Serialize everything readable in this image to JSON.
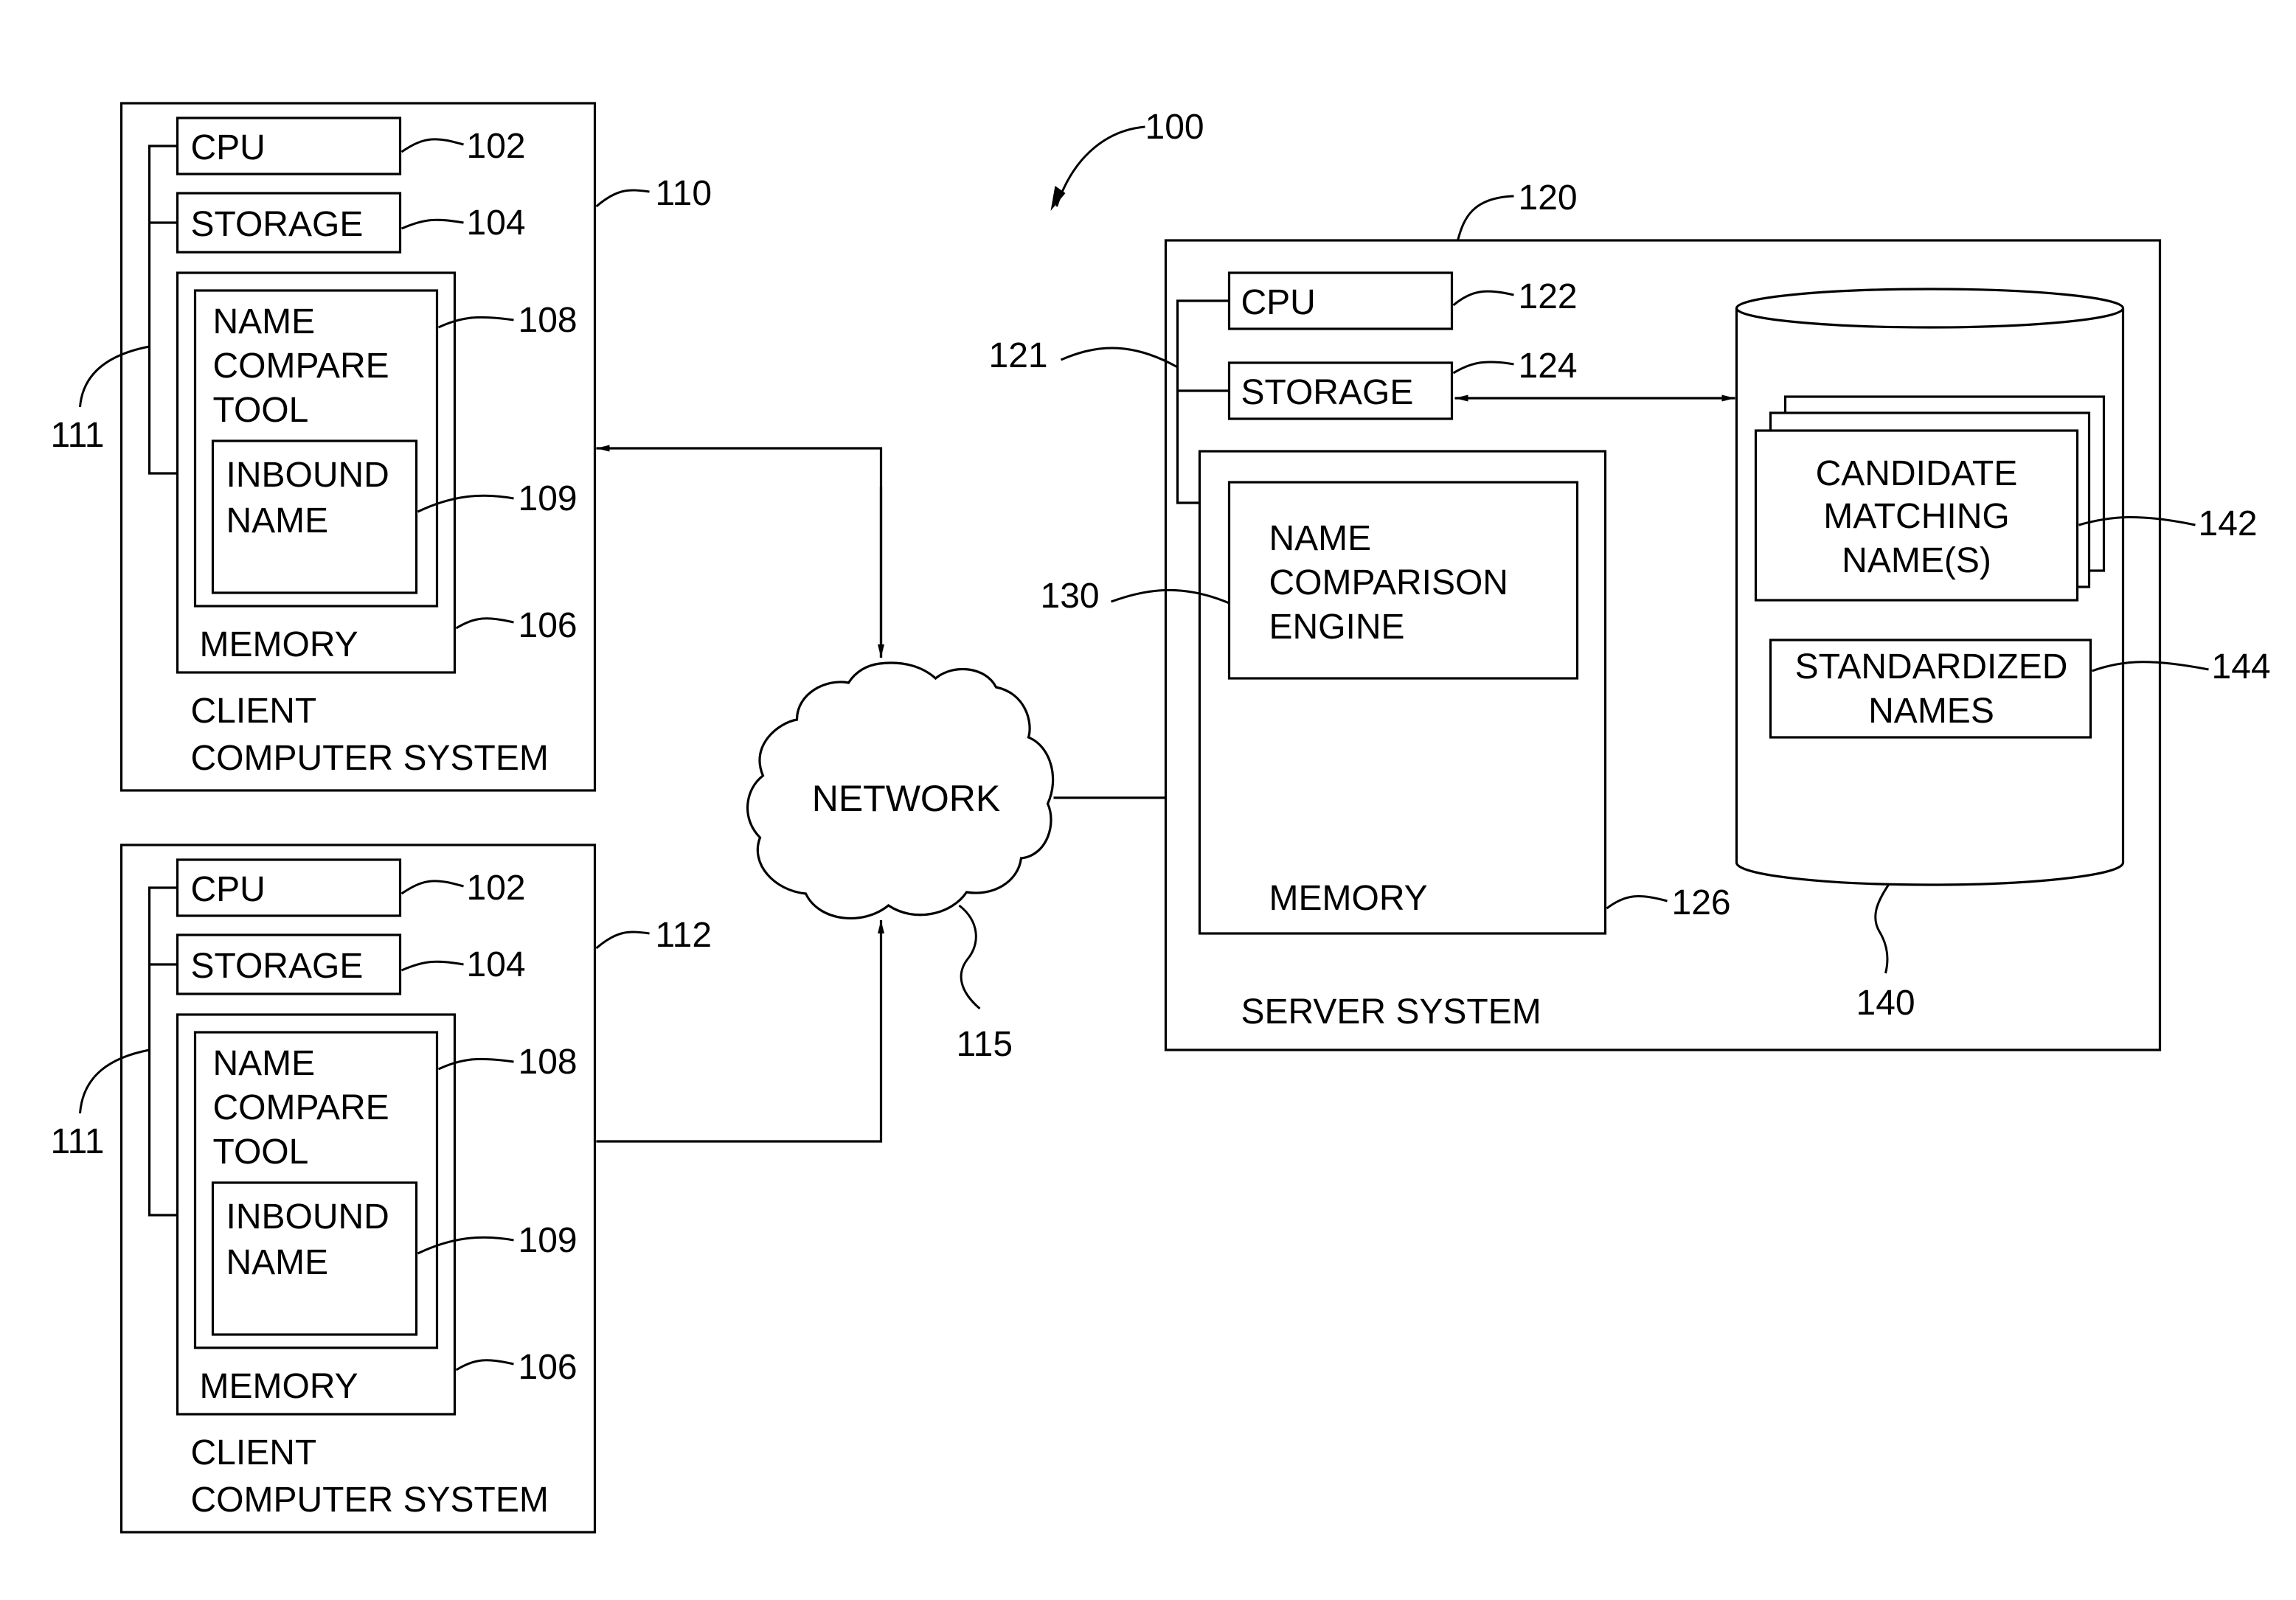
{
  "figure": {
    "ref": "100",
    "clients": [
      {
        "ref": "110",
        "title_line1": "CLIENT",
        "title_line2": "COMPUTER SYSTEM",
        "bus_ref": "111",
        "cpu": {
          "label": "CPU",
          "ref": "102"
        },
        "storage": {
          "label": "STORAGE",
          "ref": "104"
        },
        "memory": {
          "label": "MEMORY",
          "ref": "106"
        },
        "tool": {
          "line1": "NAME",
          "line2": "COMPARE",
          "line3": "TOOL",
          "ref": "108"
        },
        "inbound": {
          "line1": "INBOUND",
          "line2": "NAME",
          "ref": "109"
        }
      },
      {
        "ref": "112",
        "title_line1": "CLIENT",
        "title_line2": "COMPUTER SYSTEM",
        "bus_ref": "111",
        "cpu": {
          "label": "CPU",
          "ref": "102"
        },
        "storage": {
          "label": "STORAGE",
          "ref": "104"
        },
        "memory": {
          "label": "MEMORY",
          "ref": "106"
        },
        "tool": {
          "line1": "NAME",
          "line2": "COMPARE",
          "line3": "TOOL",
          "ref": "108"
        },
        "inbound": {
          "line1": "INBOUND",
          "line2": "NAME",
          "ref": "109"
        }
      }
    ],
    "network": {
      "label": "NETWORK",
      "ref": "115"
    },
    "server": {
      "ref": "120",
      "title": "SERVER SYSTEM",
      "bus_ref": "121",
      "cpu": {
        "label": "CPU",
        "ref": "122"
      },
      "storage": {
        "label": "STORAGE",
        "ref": "124"
      },
      "memory": {
        "label": "MEMORY",
        "ref": "126"
      },
      "engine": {
        "line1": "NAME",
        "line2": "COMPARISON",
        "line3": "ENGINE",
        "ref": "130"
      },
      "database": {
        "ref": "140",
        "candidates": {
          "line1": "CANDIDATE",
          "line2": "MATCHING",
          "line3": "NAME(S)",
          "ref": "142"
        },
        "standardized": {
          "line1": "STANDARDIZED",
          "line2": "NAMES",
          "ref": "144"
        }
      }
    }
  }
}
